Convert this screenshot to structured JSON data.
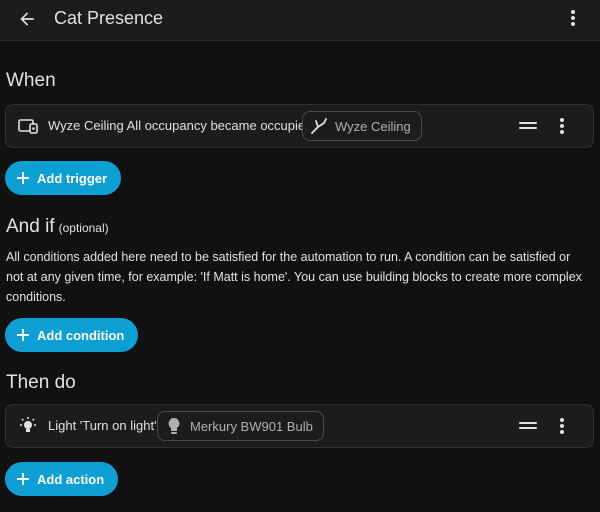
{
  "header": {
    "title": "Cat Presence",
    "back_icon": "arrow-left-icon",
    "menu_icon": "more-vert-icon"
  },
  "triggers": {
    "heading": "When",
    "items": [
      {
        "label": "Wyze Ceiling All occupancy became occupied",
        "icon": "motion-sensor-icon",
        "chip_label": "Wyze Ceiling",
        "chip_icon": "device-icon"
      }
    ],
    "add_label": "Add trigger"
  },
  "conditions": {
    "heading": "And if",
    "optional": "(optional)",
    "description": "All conditions added here need to be satisfied for the automation to run. A condition can be satisfied or not at any given time, for example: 'If Matt is home'. You can use building blocks to create more complex conditions.",
    "add_label": "Add condition"
  },
  "actions": {
    "heading": "Then do",
    "items": [
      {
        "label": "Light 'Turn on light'",
        "icon": "lightbulb-on-icon",
        "chip_label": "Merkury BW901 Bulb",
        "chip_icon": "lightbulb-icon"
      }
    ],
    "add_label": "Add action"
  },
  "colors": {
    "accent": "#0c9fd3",
    "background": "#111111",
    "card": "#1c1c1c",
    "text": "#e1e1e1"
  }
}
